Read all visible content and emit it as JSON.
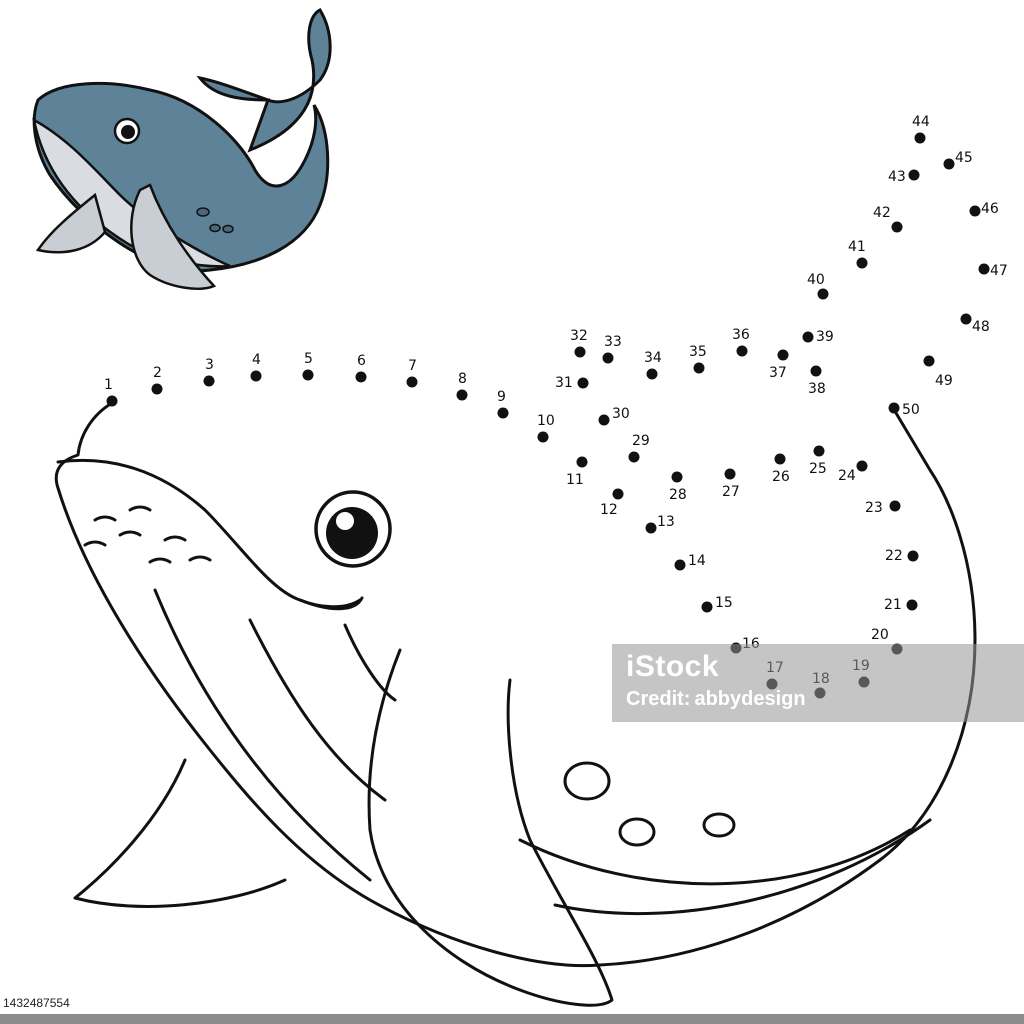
{
  "puzzle": {
    "dot_count": 50
  },
  "colors": {
    "whale_body": "#5e8398",
    "whale_belly": "#d9dde2",
    "outline": "#111111",
    "dot": "#111111"
  },
  "watermark": {
    "logo_text": "iStock",
    "credit_prefix": "Credit:",
    "credit_author": "abbydesign"
  },
  "image_id": "1432487554"
}
